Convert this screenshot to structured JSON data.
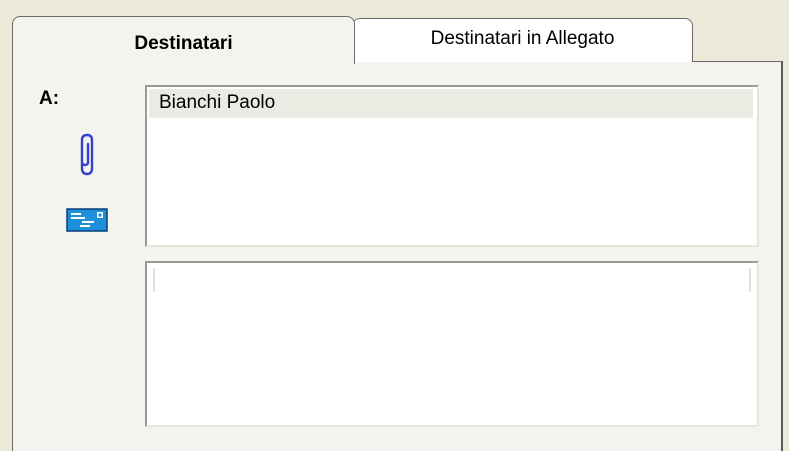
{
  "tabs": [
    {
      "label": "Destinatari",
      "active": true
    },
    {
      "label": "Destinatari in Allegato",
      "active": false
    }
  ],
  "recipients_label": "A:",
  "icons": {
    "attach": "paperclip-icon",
    "address_card": "address-card-icon"
  },
  "recipients_list": [
    "Bianchi Paolo"
  ],
  "attachment_recipients_list": [],
  "colors": {
    "background": "#ece9d8",
    "panel": "#f4f3ee",
    "paperclip": "#3344cc",
    "card": "#1e8fd8"
  }
}
